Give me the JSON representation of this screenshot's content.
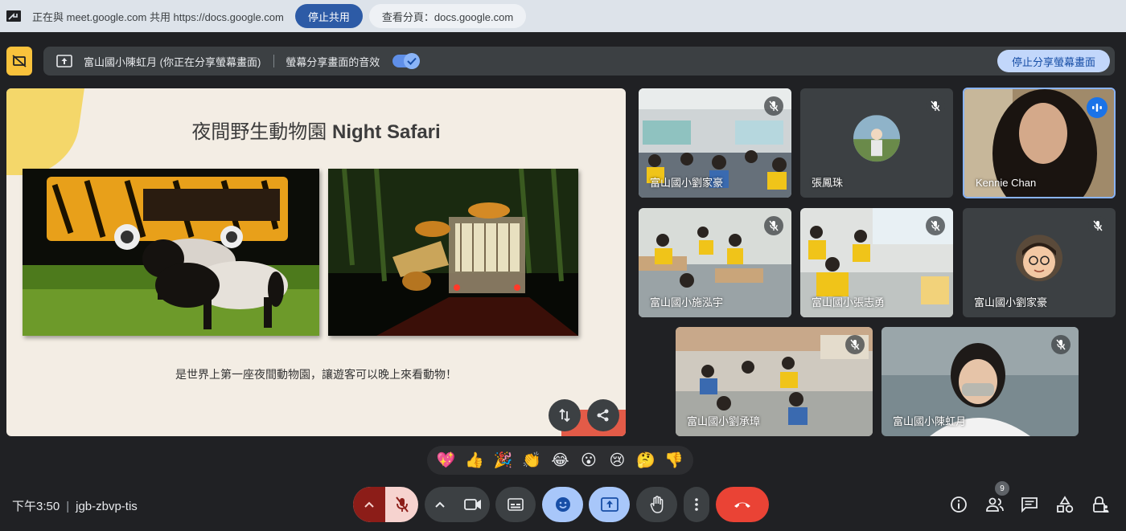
{
  "chrome_bar": {
    "share_text": "正在與 meet.google.com 共用 https://docs.google.com",
    "stop_label": "停止共用",
    "view_tab_label": "查看分頁：docs.google.com"
  },
  "present_bar": {
    "presenter": "富山國小陳虹月 (你正在分享螢幕畫面)",
    "audio_label": "螢幕分享畫面的音效",
    "audio_enabled": true,
    "stop_label": "停止分享螢幕畫面"
  },
  "slide": {
    "title_cn": "夜間野生動物園 ",
    "title_en": "Night Safari",
    "caption": "是世界上第一座夜間動物園，讓遊客可以晚上來看動物！"
  },
  "participants": [
    {
      "name": "富山國小劉家豪",
      "muted": true
    },
    {
      "name": "張鳳珠",
      "muted": true
    },
    {
      "name": "Kennie Chan",
      "muted": false,
      "speaking": true
    },
    {
      "name": "富山國小施泓宇",
      "muted": true
    },
    {
      "name": "富山國小張志勇",
      "muted": true
    },
    {
      "name": "富山國小劉家豪",
      "muted": true
    },
    {
      "name": "富山國小劉承璋",
      "muted": true
    },
    {
      "name": "富山國小陳虹月",
      "muted": true
    }
  ],
  "reactions": [
    "💖",
    "👍",
    "🎉",
    "👏",
    "😂",
    "😮",
    "😢",
    "🤔",
    "👎"
  ],
  "bottom": {
    "time": "下午3:50",
    "meeting_code": "jgb-zbvp-tis",
    "people_count": "9"
  },
  "colors": {
    "background": "#202124",
    "accent_blue": "#8ab4f8",
    "end_call_red": "#ea4335",
    "mic_off_red": "#f6d3cf"
  }
}
